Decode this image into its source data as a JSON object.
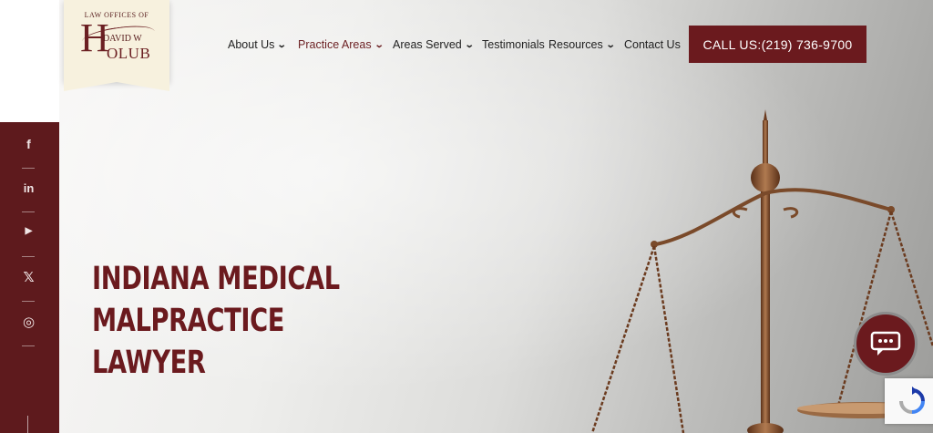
{
  "logo": {
    "top_line": "LAW OFFICES OF",
    "h_letter": "H",
    "name_middle": "DAVID W",
    "name_rest": "OLUB"
  },
  "nav": {
    "items": [
      {
        "label": "About Us",
        "has_dropdown": true,
        "active": false
      },
      {
        "label": "Practice Areas",
        "has_dropdown": true,
        "active": true
      },
      {
        "label": "Areas Served",
        "has_dropdown": true,
        "active": false
      },
      {
        "label": "Testimonials",
        "has_dropdown": false,
        "active": false
      },
      {
        "label": "Resources",
        "has_dropdown": true,
        "active": false
      },
      {
        "label": "Contact Us",
        "has_dropdown": false,
        "active": false
      }
    ],
    "call_button": "CALL US:(219) 736-9700"
  },
  "social": {
    "icons": [
      "facebook-icon",
      "linkedin-icon",
      "youtube-icon",
      "x-twitter-icon",
      "instagram-icon"
    ],
    "glyphs": {
      "facebook": "f",
      "linkedin": "in",
      "youtube": "▶",
      "x": "𝕏",
      "instagram": "◎"
    }
  },
  "hero": {
    "headline_line1": "INDIANA MEDICAL MALPRACTICE",
    "headline_line2": "LAWYER"
  },
  "colors": {
    "brand_maroon": "#6b1a1e",
    "sidebar": "#5e1a1d",
    "logo_bg": "#f7f1de",
    "bronze": "#8a5a36"
  }
}
